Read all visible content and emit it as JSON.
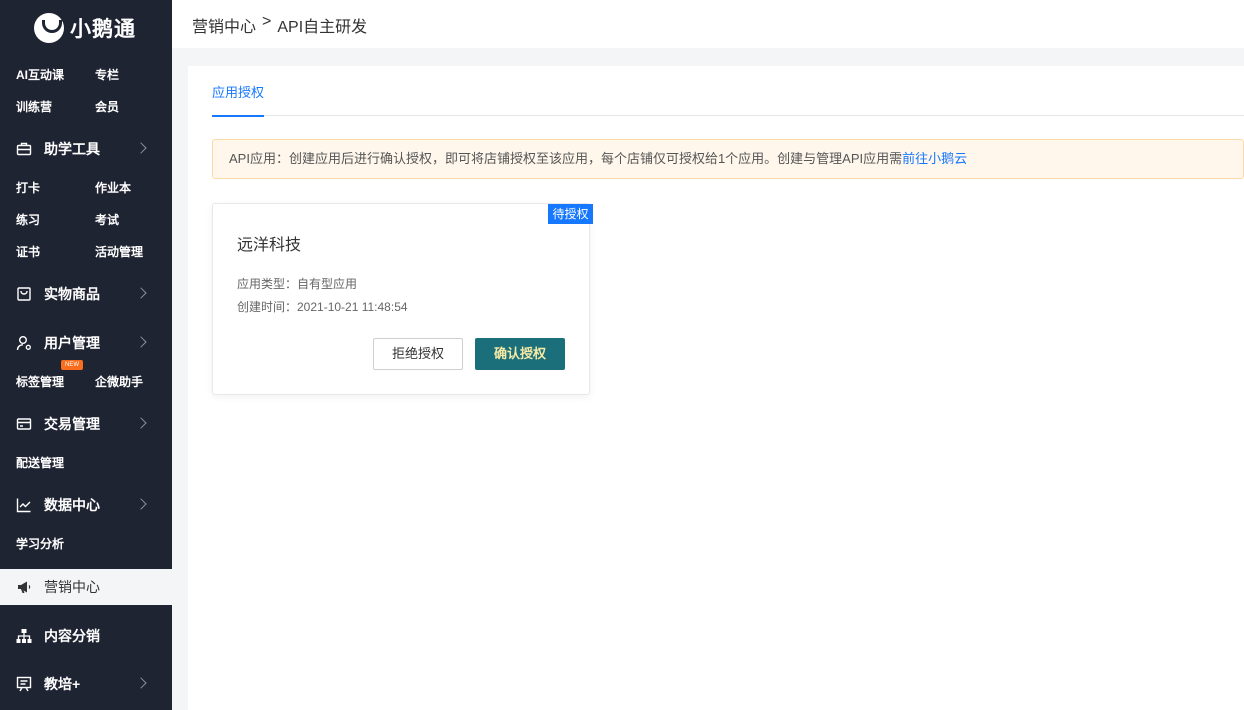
{
  "brand": {
    "name": "小鹅通"
  },
  "sidebar": {
    "top_links": [
      "AI互动课",
      "专栏",
      "训练营",
      "会员"
    ],
    "groups": [
      {
        "label": "助学工具",
        "icon": "toolbox-icon",
        "children": [
          "打卡",
          "作业本",
          "练习",
          "考试",
          "证书",
          "活动管理"
        ]
      },
      {
        "label": "实物商品",
        "icon": "shopping-bag-icon",
        "children": []
      },
      {
        "label": "用户管理",
        "icon": "user-settings-icon",
        "children": [
          "标签管理",
          "企微助手"
        ],
        "badge": "NEW"
      },
      {
        "label": "交易管理",
        "icon": "card-icon",
        "children": [
          "配送管理"
        ]
      },
      {
        "label": "数据中心",
        "icon": "chart-line-icon",
        "children": [
          "学习分析"
        ]
      },
      {
        "label": "营销中心",
        "icon": "megaphone-icon",
        "children": [],
        "active": true
      },
      {
        "label": "内容分销",
        "icon": "hierarchy-icon",
        "children": []
      },
      {
        "label": "教培+",
        "icon": "presentation-icon",
        "children": []
      }
    ]
  },
  "header": {
    "breadcrumb": [
      "营销中心",
      ">",
      "API自主研发"
    ]
  },
  "tabs": [
    {
      "label": "应用授权",
      "active": true
    }
  ],
  "notice": {
    "text": "API应用：创建应用后进行确认授权，即可将店铺授权至该应用，每个店铺仅可授权给1个应用。创建与管理API应用需",
    "link": "前往小鹅云"
  },
  "card": {
    "status": "待授权",
    "title": "远洋科技",
    "type_label": "应用类型：自有型应用",
    "created_label": "创建时间：2021-10-21 11:48:54",
    "reject_label": "拒绝授权",
    "confirm_label": "确认授权"
  },
  "colors": {
    "sidebar_bg": "#1f2433",
    "accent": "#1677ff",
    "confirm_bg": "#1b6f7a",
    "notice_bg": "#fff7ec"
  }
}
